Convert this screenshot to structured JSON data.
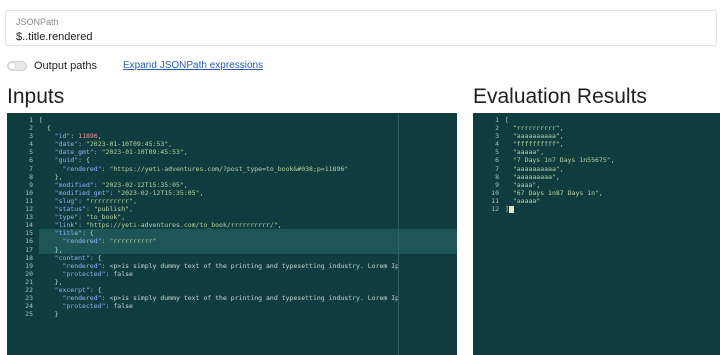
{
  "jsonpath": {
    "label": "JSONPath",
    "value": "$..title.rendered"
  },
  "options": {
    "output_paths_label": "Output paths",
    "expand_link": "Expand JSONPath expressions"
  },
  "inputs": {
    "heading": "Inputs",
    "lines": [
      {
        "n": "1",
        "t": "["
      },
      {
        "n": "2",
        "t": "  {"
      },
      {
        "n": "3",
        "t": "    \"id\": 11896,"
      },
      {
        "n": "4",
        "t": "    \"date\": \"2023-01-10T09:45:53\","
      },
      {
        "n": "5",
        "t": "    \"date_gmt\": \"2023-01-10T09:45:53\","
      },
      {
        "n": "6",
        "t": "    \"guid\": {"
      },
      {
        "n": "7",
        "t": "      \"rendered\": \"https://yeti-adventures.com/?post_type=to_book&#038;p=11896\""
      },
      {
        "n": "8",
        "t": "    },"
      },
      {
        "n": "9",
        "t": "    \"modified\": \"2023-02-12T15:35:05\","
      },
      {
        "n": "10",
        "t": "    \"modified_gmt\": \"2023-02-12T15:35:05\","
      },
      {
        "n": "11",
        "t": "    \"slug\": \"rrrrrrrrrr\","
      },
      {
        "n": "12",
        "t": "    \"status\": \"publish\","
      },
      {
        "n": "13",
        "t": "    \"type\": \"to_book\","
      },
      {
        "n": "14",
        "t": "    \"link\": \"https://yeti-adventures.com/to_book/rrrrrrrrrr/\","
      },
      {
        "n": "15",
        "t": "    \"title\": {"
      },
      {
        "n": "16",
        "t": "      \"rendered\": \"rrrrrrrrrr\""
      },
      {
        "n": "17",
        "t": "    },"
      },
      {
        "n": "18",
        "t": "    \"content\": {"
      },
      {
        "n": "19",
        "t": "      \"rendered\": \"<p>is simply dummy text of the printing and typesetting industry. Lorem Ip"
      },
      {
        "n": "20",
        "t": "      \"protected\": false"
      },
      {
        "n": "21",
        "t": "    },"
      },
      {
        "n": "22",
        "t": "    \"excerpt\": {"
      },
      {
        "n": "23",
        "t": "      \"rendered\": \"<p>is simply dummy text of the printing and typesetting industry. Lorem Ip"
      },
      {
        "n": "24",
        "t": "      \"protected\": false"
      },
      {
        "n": "25",
        "t": "    }"
      }
    ]
  },
  "results": {
    "heading": "Evaluation Results",
    "lines": [
      {
        "n": "1",
        "t": "["
      },
      {
        "n": "2",
        "t": "  \"rrrrrrrrrr\","
      },
      {
        "n": "3",
        "t": "  \"aaaaaaaaaa\","
      },
      {
        "n": "4",
        "t": "  \"ffffffffff\","
      },
      {
        "n": "5",
        "t": "  \"aaaaa\","
      },
      {
        "n": "6",
        "t": "  \"7 Days 1n7 Days 1n55675\","
      },
      {
        "n": "7",
        "t": "  \"aaaaaaaaaa\","
      },
      {
        "n": "8",
        "t": "  \"aaaaaaaaa\","
      },
      {
        "n": "9",
        "t": "  \"aaaa\","
      },
      {
        "n": "10",
        "t": "  \"67 Days 1n87 Days 1n\","
      },
      {
        "n": "11",
        "t": "  \"aaaaa\""
      },
      {
        "n": "12",
        "t": "]"
      }
    ]
  },
  "colors": {
    "editor_bg": "#0f3c3e",
    "link": "#2a5db0",
    "key": "#8fb4ff",
    "string": "#b7d3a6",
    "number": "#ff8fa0"
  }
}
